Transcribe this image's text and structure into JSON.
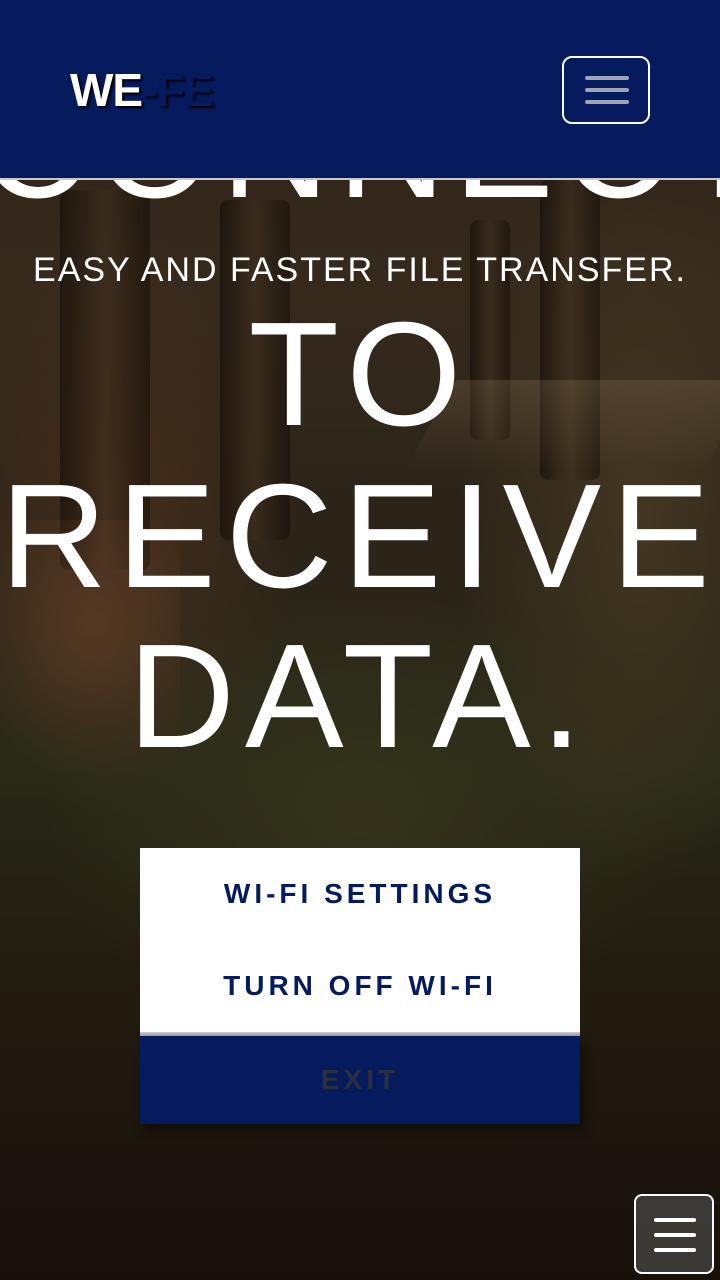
{
  "navbar": {
    "brand_primary": "WE",
    "brand_separator": "-",
    "brand_secondary": "FE",
    "toggle_icon": "hamburger-icon"
  },
  "hero": {
    "cut_off_word": "CONNECT",
    "tagline": "EASY AND FASTER FILE TRANSFER.",
    "line_1": "TO",
    "line_2": "RECEIVE",
    "line_3": "DATA."
  },
  "menu": {
    "wifi_settings": "WI-FI SETTINGS",
    "turn_off_wifi": "TURN OFF WI-FI",
    "exit": "EXIT"
  },
  "floating_button": {
    "icon": "hamburger-icon"
  },
  "colors": {
    "primary": "#061a5e",
    "text_light": "#ffffff"
  }
}
